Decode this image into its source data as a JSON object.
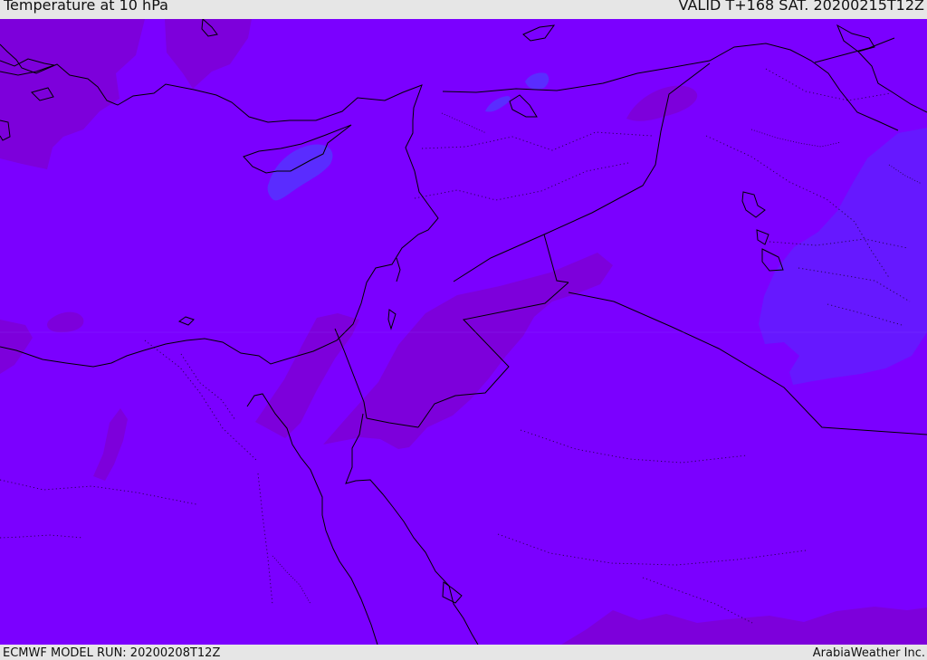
{
  "header": {
    "title": "Temperature at 10 hPa",
    "valid_time": "VALID T+168 SAT. 20200215T12Z"
  },
  "footer": {
    "model_run": "ECMWF MODEL RUN: 20200208T12Z",
    "credit": "ArabiaWeather Inc."
  },
  "map": {
    "colors": {
      "background_field": "#7b00ff",
      "warmer_field": "#7d00db",
      "colder_field": "#6618ff",
      "cold_spot": "#5a2cff",
      "coastline": "#000000",
      "border": "#000000",
      "frame": "#e6e6e6"
    }
  }
}
